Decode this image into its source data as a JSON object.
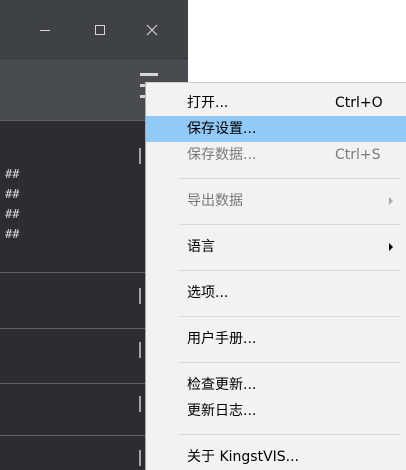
{
  "window": {
    "controls": [
      "minimize-icon",
      "maximize-icon",
      "close-icon"
    ],
    "toolbar": {
      "menu_button_icon": "hamburger-menu-icon"
    },
    "channel_labels": [
      "##",
      "##",
      "##",
      "##"
    ]
  },
  "menu": {
    "groups": [
      [
        {
          "label": "打开...",
          "shortcut": "Ctrl+O",
          "enabled": true
        },
        {
          "label": "保存设置...",
          "enabled": true,
          "highlighted": true
        },
        {
          "label": "保存数据...",
          "shortcut": "Ctrl+S",
          "enabled": false
        }
      ],
      [
        {
          "label": "导出数据",
          "enabled": false,
          "submenu_icon": "submenu-arrow-icon"
        }
      ],
      [
        {
          "label": "语言",
          "enabled": true,
          "submenu_icon": "submenu-arrow-icon"
        }
      ],
      [
        {
          "label": "选项...",
          "enabled": true
        }
      ],
      [
        {
          "label": "用户手册...",
          "enabled": true
        }
      ],
      [
        {
          "label": "检查更新...",
          "enabled": true
        },
        {
          "label": "更新日志...",
          "enabled": true
        }
      ],
      [
        {
          "label": "关于 KingstVIS...",
          "enabled": true
        }
      ]
    ]
  },
  "colors": {
    "title_bar": "#3e4245",
    "toolbar": "#484c50",
    "panel": "#2b2d30",
    "menu_background": "#f2f2f2",
    "menu_highlight": "#91c9f7",
    "disabled_text": "#7a7a7a"
  }
}
